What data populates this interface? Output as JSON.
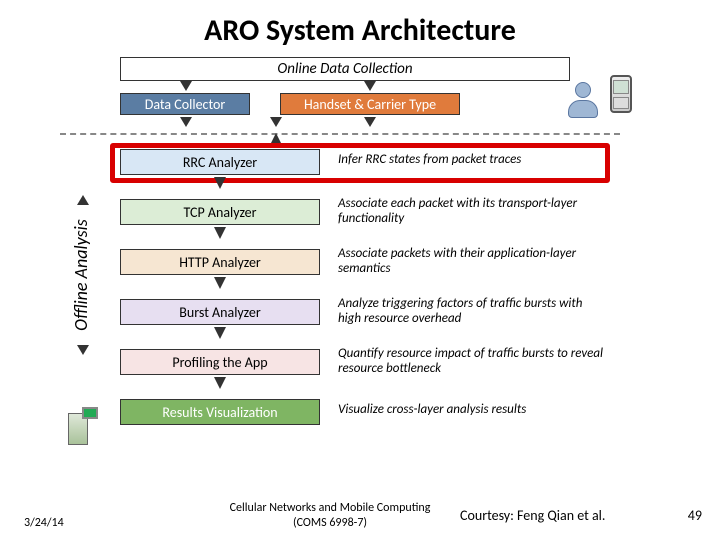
{
  "title": "ARO System Architecture",
  "online_header": "Online Data Collection",
  "offline_label": "Offline Analysis",
  "top": {
    "data_collector": "Data Collector",
    "handset": "Handset & Carrier Type"
  },
  "stages": [
    {
      "label": "RRC Analyzer",
      "bg": "#d8e7f5",
      "desc": "Infer RRC states from packet traces",
      "highlight": true
    },
    {
      "label": "TCP Analyzer",
      "bg": "#dcedd6",
      "desc": "Associate each packet with its transport-layer functionality"
    },
    {
      "label": "HTTP Analyzer",
      "bg": "#f6e6d2",
      "desc": "Associate packets with their application-layer semantics"
    },
    {
      "label": "Burst Analyzer",
      "bg": "#e7dff1",
      "desc": "Analyze triggering factors of traffic bursts with high resource overhead"
    },
    {
      "label": "Profiling the App",
      "bg": "#f7e4e4",
      "desc": "Quantify resource impact of traffic bursts to reveal resource bottleneck"
    },
    {
      "label": "Results Visualization",
      "bg": "#7fb563",
      "desc": "Visualize cross-layer analysis results",
      "fg": "#fff"
    }
  ],
  "footer": {
    "date": "3/24/14",
    "course_line1": "Cellular Networks and Mobile Computing",
    "course_line2": "(COMS 6998-7)",
    "courtesy": "Courtesy: Feng Qian et al.",
    "page": "49"
  },
  "chart_data": {
    "type": "diagram",
    "title": "ARO System Architecture",
    "sections": {
      "Online Data Collection": [
        "Data Collector",
        "Handset & Carrier Type"
      ],
      "Offline Analysis": [
        "RRC Analyzer",
        "TCP Analyzer",
        "HTTP Analyzer",
        "Burst Analyzer",
        "Profiling the App",
        "Results Visualization"
      ]
    },
    "highlighted_stage": "RRC Analyzer",
    "flow": "top-down sequential pipeline; both online boxes feed into RRC Analyzer; each stage feeds the next; Results Visualization is terminal",
    "annotations": {
      "RRC Analyzer": "Infer RRC states from packet traces",
      "TCP Analyzer": "Associate each packet with its transport-layer functionality",
      "HTTP Analyzer": "Associate packets with their application-layer semantics",
      "Burst Analyzer": "Analyze triggering factors of traffic bursts with high resource overhead",
      "Profiling the App": "Quantify resource impact of traffic bursts to reveal resource bottleneck",
      "Results Visualization": "Visualize cross-layer analysis results"
    }
  }
}
